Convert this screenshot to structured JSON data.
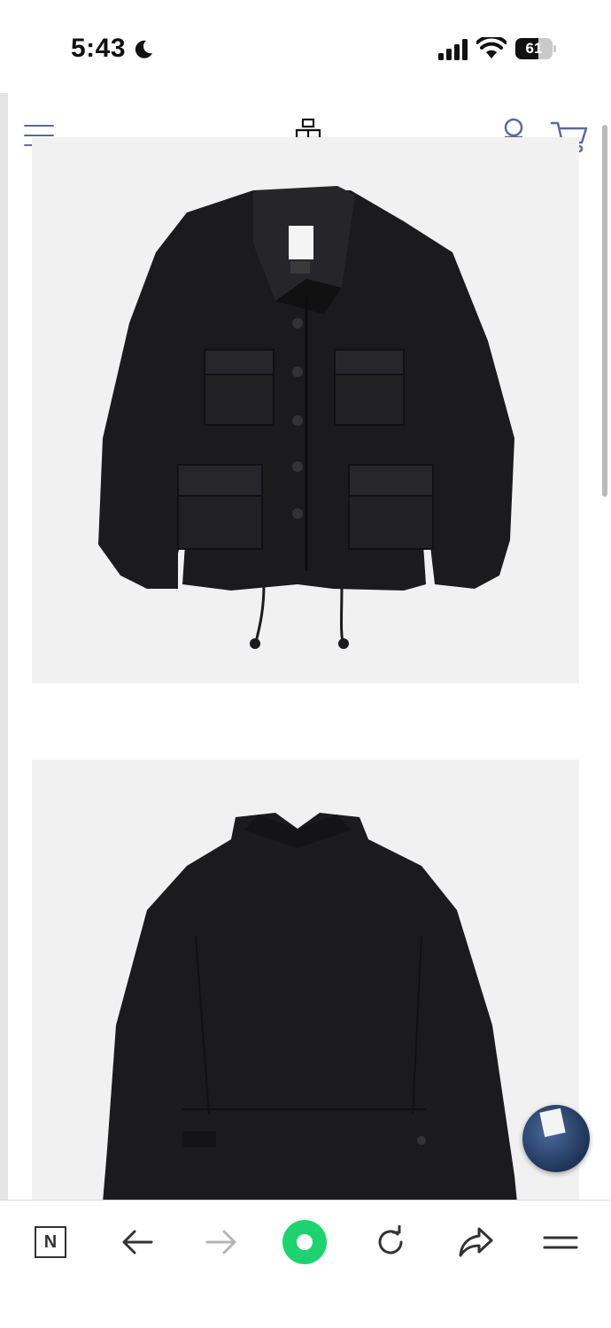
{
  "status_bar": {
    "time": "5:43",
    "battery": "61",
    "battery_level": 0.61
  },
  "header": {
    "icons": [
      "menu-icon",
      "brand-logo-icon",
      "account-icon",
      "cart-icon"
    ]
  },
  "product_images": [
    {
      "view": "front",
      "subject": "black-linen-jacket"
    },
    {
      "view": "back",
      "subject": "black-linen-jacket"
    }
  ],
  "toolbar": {
    "n_label": "N",
    "buttons": [
      "n-icon",
      "back-arrow-icon",
      "forward-arrow-icon",
      "home-icon",
      "reload-icon",
      "share-icon",
      "more-icon"
    ]
  },
  "colors": {
    "accent": "#5b6a9c",
    "home_button": "#1ed36f",
    "image_background": "#f1f1f1",
    "jacket": "#1b1b1d"
  }
}
